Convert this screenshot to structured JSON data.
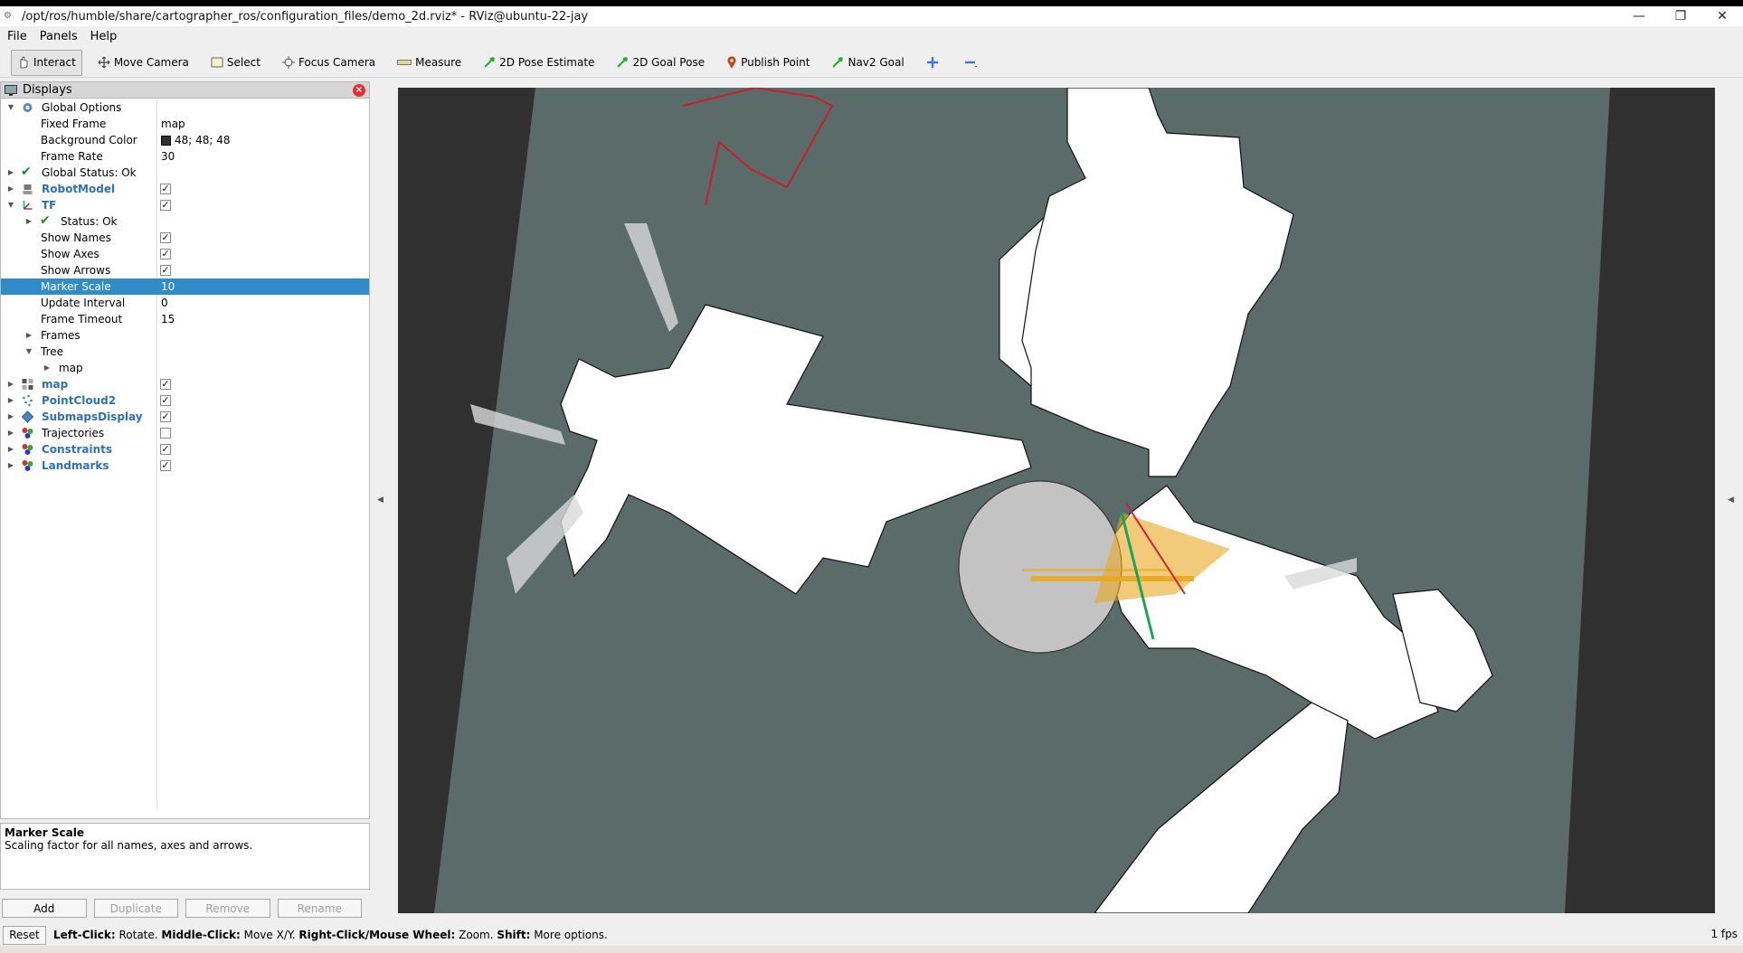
{
  "window": {
    "title": "/opt/ros/humble/share/cartographer_ros/configuration_files/demo_2d.rviz* - RViz@ubuntu-22-jay",
    "minimize": "—",
    "restore": "❐",
    "close": "✕"
  },
  "menu": [
    "File",
    "Panels",
    "Help"
  ],
  "toolbar": {
    "tools": [
      {
        "label": "Interact",
        "icon": "hand-icon",
        "active": true
      },
      {
        "label": "Move Camera",
        "icon": "move-camera-icon"
      },
      {
        "label": "Select",
        "icon": "select-icon"
      },
      {
        "label": "Focus Camera",
        "icon": "focus-camera-icon"
      },
      {
        "label": "Measure",
        "icon": "ruler-icon"
      },
      {
        "label": "2D Pose Estimate",
        "icon": "green-arrow-icon"
      },
      {
        "label": "2D Goal Pose",
        "icon": "green-arrow-icon"
      },
      {
        "label": "Publish Point",
        "icon": "map-pin-icon"
      },
      {
        "label": "Nav2 Goal",
        "icon": "green-arrow-icon"
      }
    ],
    "colors": {
      "pose_arrow": "#1fb02a",
      "pin": "#c2461c",
      "plus": "#3d79c9"
    }
  },
  "displays_panel": {
    "title": "Displays",
    "close": "×",
    "rows": {
      "global_options": "Global Options",
      "fixed_frame": {
        "label": "Fixed Frame",
        "value": "map"
      },
      "background_color": {
        "label": "Background Color",
        "value": "48; 48; 48"
      },
      "frame_rate": {
        "label": "Frame Rate",
        "value": "30"
      },
      "global_status": "Global Status: Ok",
      "robot_model": "RobotModel",
      "tf": "TF",
      "tf_status": "Status: Ok",
      "show_names": "Show Names",
      "show_axes": "Show Axes",
      "show_arrows": "Show Arrows",
      "marker_scale": {
        "label": "Marker Scale",
        "value": "10"
      },
      "update_interval": {
        "label": "Update Interval",
        "value": "0"
      },
      "frame_timeout": {
        "label": "Frame Timeout",
        "value": "15"
      },
      "frames": "Frames",
      "tree": "Tree",
      "tree_map": "map",
      "map": "map",
      "pointcloud2": "PointCloud2",
      "submaps": "SubmapsDisplay",
      "trajectories": "Trajectories",
      "constraints": "Constraints",
      "landmarks": "Landmarks"
    },
    "checkbox_glyph": "✓",
    "status_glyph": "✔"
  },
  "description": {
    "title": "Marker Scale",
    "text": "Scaling factor for all names, axes and arrows."
  },
  "panel_buttons": [
    "Add",
    "Duplicate",
    "Remove",
    "Rename"
  ],
  "statusbar": {
    "reset": "Reset",
    "hint_parts": [
      {
        "b": "Left-Click:",
        "t": " Rotate. "
      },
      {
        "b": "Middle-Click:",
        "t": " Move X/Y. "
      },
      {
        "b": "Right-Click/Mouse Wheel:",
        "t": " Zoom. "
      },
      {
        "b": "Shift:",
        "t": " More options."
      }
    ],
    "fps": "1 fps"
  },
  "viewport": {
    "background": "#303030",
    "ground": "#5b6b6a",
    "free_space": "#ffffff",
    "submap_disc": "#c3c3c3",
    "pointcloud": "#e8a820",
    "constraint_red": "#cc2233",
    "constraint_green": "#1aa35a",
    "trajectory_red": "#c8202a"
  }
}
